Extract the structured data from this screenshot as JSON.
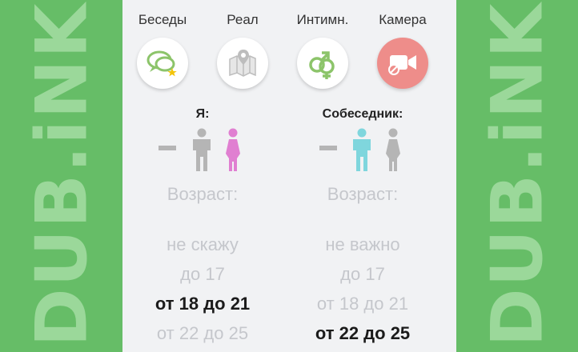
{
  "watermark": "DUB.iNK",
  "modes": [
    {
      "label": "Беседы",
      "icon": "chat-bubbles-icon"
    },
    {
      "label": "Реал",
      "icon": "map-pin-icon"
    },
    {
      "label": "Интимн.",
      "icon": "gender-symbols-icon"
    },
    {
      "label": "Камера",
      "icon": "video-camera-off-icon"
    }
  ],
  "me": {
    "title": "Я:",
    "age_label": "Возраст:",
    "ages": [
      "не скажу",
      "до 17",
      "от 18 до 21",
      "от 22 до 25"
    ],
    "selected_age": "от 18 до 21",
    "selected_gender": "female"
  },
  "partner": {
    "title": "Собеседник:",
    "age_label": "Возраст:",
    "ages": [
      "не важно",
      "до 17",
      "от 18 до 21",
      "от 22 до 25"
    ],
    "selected_age": "от 22 до 25",
    "selected_gender": "male"
  },
  "colors": {
    "background": "#66bd67",
    "watermark": "#9bd89a",
    "panel": "#f1f2f4",
    "chat_icon": "#8cc46a",
    "map_icon": "#cfcfcf",
    "gender_icon": "#8cc46a",
    "camera_button": "#ee8d8a",
    "female_selected": "#e07fd1",
    "male_selected": "#7fd6dd",
    "unselected": "#b5b5b5",
    "muted_text": "#c5c7cc"
  }
}
